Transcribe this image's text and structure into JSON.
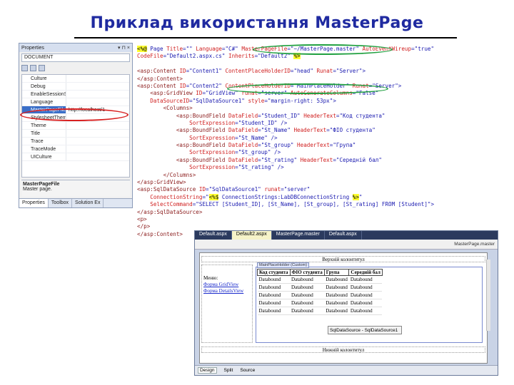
{
  "slide": {
    "title": "Приклад використання MasterPage"
  },
  "properties": {
    "header": "Properties",
    "header_controls": "▾ ⊓ ×",
    "object": "DOCUMENT",
    "rows": [
      {
        "name": "Culture",
        "value": ""
      },
      {
        "name": "Debug",
        "value": ""
      },
      {
        "name": "EnableSessionSte",
        "value": ""
      },
      {
        "name": "Language",
        "value": ""
      },
      {
        "name": "MasterPageFile",
        "value": "http://localhost/1"
      },
      {
        "name": "StylesheetTheme",
        "value": ""
      },
      {
        "name": "Theme",
        "value": ""
      },
      {
        "name": "Title",
        "value": ""
      },
      {
        "name": "Trace",
        "value": ""
      },
      {
        "name": "TraceMode",
        "value": ""
      },
      {
        "name": "UICulture",
        "value": ""
      }
    ],
    "desc_title": "MasterPageFile",
    "desc_text": "Master page.",
    "tabs": [
      "Properties",
      "Toolbox",
      "Solution Ex"
    ]
  },
  "code": {
    "lines": [
      [
        {
          "c": "hl",
          "t": "<%@"
        },
        {
          "c": "v",
          "t": " Page "
        },
        {
          "c": "a",
          "t": "Title"
        },
        {
          "c": "v",
          "t": "=\"\" "
        },
        {
          "c": "a",
          "t": "Language"
        },
        {
          "c": "v",
          "t": "=\"C#\" "
        },
        {
          "c": "a",
          "t": "MasterPageFile"
        },
        {
          "c": "v",
          "t": "=\"~/MasterPage.master\" "
        },
        {
          "c": "a",
          "t": "AutoEventWireup"
        },
        {
          "c": "v",
          "t": "=\"true\""
        }
      ],
      [
        {
          "c": "a",
          "t": "CodeFile"
        },
        {
          "c": "v",
          "t": "=\"Default2.aspx.cs\" "
        },
        {
          "c": "a",
          "t": "Inherits"
        },
        {
          "c": "v",
          "t": "=\"Default2\" "
        },
        {
          "c": "hl",
          "t": "%>"
        }
      ],
      [],
      [
        {
          "c": "t",
          "t": "<asp:Content "
        },
        {
          "c": "a",
          "t": "ID"
        },
        {
          "c": "v",
          "t": "=\"Content1\" "
        },
        {
          "c": "a",
          "t": "ContentPlaceHolderID"
        },
        {
          "c": "v",
          "t": "=\"head\" "
        },
        {
          "c": "a",
          "t": "Runat"
        },
        {
          "c": "v",
          "t": "=\"Server\">"
        }
      ],
      [
        {
          "c": "t",
          "t": "</asp:Content>"
        }
      ],
      [
        {
          "c": "t",
          "t": "<asp:Content "
        },
        {
          "c": "a",
          "t": "ID"
        },
        {
          "c": "v",
          "t": "=\"Content2\" "
        },
        {
          "c": "a",
          "t": "ContentPlaceHolderID"
        },
        {
          "c": "v",
          "t": "=\"MainPlaceHolder\" "
        },
        {
          "c": "a",
          "t": "Runat"
        },
        {
          "c": "v",
          "t": "=\"Server\">"
        }
      ],
      [
        {
          "c": "t",
          "t": "    <asp:GridView "
        },
        {
          "c": "a",
          "t": "ID"
        },
        {
          "c": "v",
          "t": "=\"GridView\" "
        },
        {
          "c": "a",
          "t": "runat"
        },
        {
          "c": "v",
          "t": "=\"server\" "
        },
        {
          "c": "a",
          "t": "AutoGenerateColumns"
        },
        {
          "c": "v",
          "t": "=\"False\""
        }
      ],
      [
        {
          "c": "a",
          "t": "    DataSourceID"
        },
        {
          "c": "v",
          "t": "=\"SqlDataSource1\" "
        },
        {
          "c": "a",
          "t": "style"
        },
        {
          "c": "v",
          "t": "=\"margin-right: 53px\">"
        }
      ],
      [
        {
          "c": "t",
          "t": "        <Columns>"
        }
      ],
      [
        {
          "c": "t",
          "t": "            <asp:BoundField "
        },
        {
          "c": "a",
          "t": "DataField"
        },
        {
          "c": "v",
          "t": "=\"Student_ID\" "
        },
        {
          "c": "a",
          "t": "HeaderText"
        },
        {
          "c": "v",
          "t": "=\"Код студента\""
        }
      ],
      [
        {
          "c": "a",
          "t": "                SortExpression"
        },
        {
          "c": "v",
          "t": "=\"Student_ID\" />"
        }
      ],
      [
        {
          "c": "t",
          "t": "            <asp:BoundField "
        },
        {
          "c": "a",
          "t": "DataField"
        },
        {
          "c": "v",
          "t": "=\"St_Name\" "
        },
        {
          "c": "a",
          "t": "HeaderText"
        },
        {
          "c": "v",
          "t": "=\"ФІО студента\""
        }
      ],
      [
        {
          "c": "a",
          "t": "                SortExpression"
        },
        {
          "c": "v",
          "t": "=\"St_Name\" />"
        }
      ],
      [
        {
          "c": "t",
          "t": "            <asp:BoundField "
        },
        {
          "c": "a",
          "t": "DataField"
        },
        {
          "c": "v",
          "t": "=\"St_group\" "
        },
        {
          "c": "a",
          "t": "HeaderText"
        },
        {
          "c": "v",
          "t": "=\"Група\""
        }
      ],
      [
        {
          "c": "a",
          "t": "                SortExpression"
        },
        {
          "c": "v",
          "t": "=\"St_group\" />"
        }
      ],
      [
        {
          "c": "t",
          "t": "            <asp:BoundField "
        },
        {
          "c": "a",
          "t": "DataField"
        },
        {
          "c": "v",
          "t": "=\"St_rating\" "
        },
        {
          "c": "a",
          "t": "HeaderText"
        },
        {
          "c": "v",
          "t": "=\"Середній бал\""
        }
      ],
      [
        {
          "c": "a",
          "t": "                SortExpression"
        },
        {
          "c": "v",
          "t": "=\"St_rating\" />"
        }
      ],
      [
        {
          "c": "t",
          "t": "        </Columns>"
        }
      ],
      [
        {
          "c": "t",
          "t": "</asp:GridView>"
        }
      ],
      [
        {
          "c": "t",
          "t": "<asp:SqlDataSource "
        },
        {
          "c": "a",
          "t": "ID"
        },
        {
          "c": "v",
          "t": "=\"SqlDataSource1\" "
        },
        {
          "c": "a",
          "t": "runat"
        },
        {
          "c": "v",
          "t": "=\"server\""
        }
      ],
      [
        {
          "c": "a",
          "t": "    ConnectionString"
        },
        {
          "c": "v",
          "t": "=\""
        },
        {
          "c": "hl",
          "t": "<%$"
        },
        {
          "c": "v",
          "t": " ConnectionStrings:LabDBConnectionString "
        },
        {
          "c": "hl",
          "t": "%>"
        },
        {
          "c": "v",
          "t": "\""
        }
      ],
      [
        {
          "c": "a",
          "t": "    SelectCommand"
        },
        {
          "c": "v",
          "t": "=\"SELECT [Student_ID], [St_Name], [St_group], [St_rating] FROM [Student]\">"
        }
      ],
      [
        {
          "c": "t",
          "t": "</asp:SqlDataSource>"
        }
      ],
      [
        {
          "c": "t",
          "t": "<p>"
        }
      ],
      [
        {
          "c": "t",
          "t": "</p>"
        }
      ],
      [
        {
          "c": "t",
          "t": "</asp:Content>"
        }
      ]
    ]
  },
  "designer": {
    "tabs": [
      "Default.aspx",
      "Default2.aspx",
      "MasterPage.master",
      "Default.aspx"
    ],
    "active_tab_index": 1,
    "master_path": "MasterPage.master",
    "header_text": "Верхній колонтитул",
    "cp_label": "MainPlaceHolder (Custom)",
    "left_menu": {
      "title": "Меню:",
      "links": [
        "Форма GridView",
        "Форма DetailsView"
      ]
    },
    "grid": {
      "columns": [
        "Код студента",
        "ФІО студента",
        "Група",
        "Середній бал"
      ],
      "rows": [
        [
          "Databound",
          "Databound",
          "Databound",
          "Databound"
        ],
        [
          "Databound",
          "Databound",
          "Databound",
          "Databound"
        ],
        [
          "Databound",
          "Databound",
          "Databound",
          "Databound"
        ],
        [
          "Databound",
          "Databound",
          "Databound",
          "Databound"
        ],
        [
          "Databound",
          "Databound",
          "Databound",
          "Databound"
        ]
      ]
    },
    "sqlsource": "SqlDataSource - SqlDataSource1",
    "footer_text": "Нижній колонтитул",
    "bottom": [
      "Design",
      "Split",
      "Source"
    ]
  }
}
